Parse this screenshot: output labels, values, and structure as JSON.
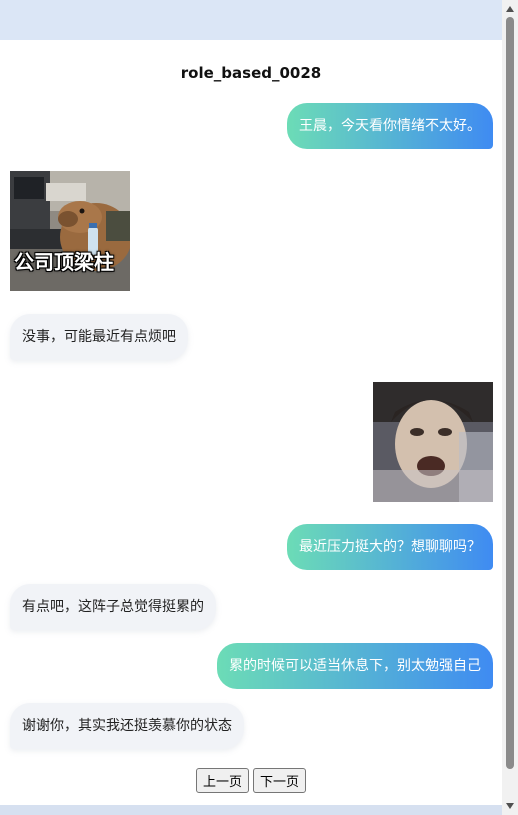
{
  "title": "role_based_0028",
  "messages": [
    {
      "side": "right",
      "type": "text",
      "text": "王晨，今天看你情绪不太好。"
    },
    {
      "side": "left",
      "type": "sticker",
      "caption": "公司顶梁柱",
      "icon": "capybara-office-sticker"
    },
    {
      "side": "left",
      "type": "text",
      "text": "没事，可能最近有点烦吧"
    },
    {
      "side": "right",
      "type": "sticker",
      "icon": "crying-face-sticker"
    },
    {
      "side": "right",
      "type": "text",
      "text": "最近压力挺大的？想聊聊吗？"
    },
    {
      "side": "left",
      "type": "text",
      "text": "有点吧，这阵子总觉得挺累的"
    },
    {
      "side": "right",
      "type": "text",
      "text": "累的时候可以适当休息下，别太勉强自己"
    },
    {
      "side": "left",
      "type": "text",
      "text": "谢谢你，其实我还挺羡慕你的状态"
    }
  ],
  "pager": {
    "prev_label": "上一页",
    "next_label": "下一页"
  },
  "colors": {
    "me_gradient_start": "#6cdcb6",
    "me_gradient_end": "#3f8bf2",
    "other_bubble": "#f1f3f7"
  }
}
